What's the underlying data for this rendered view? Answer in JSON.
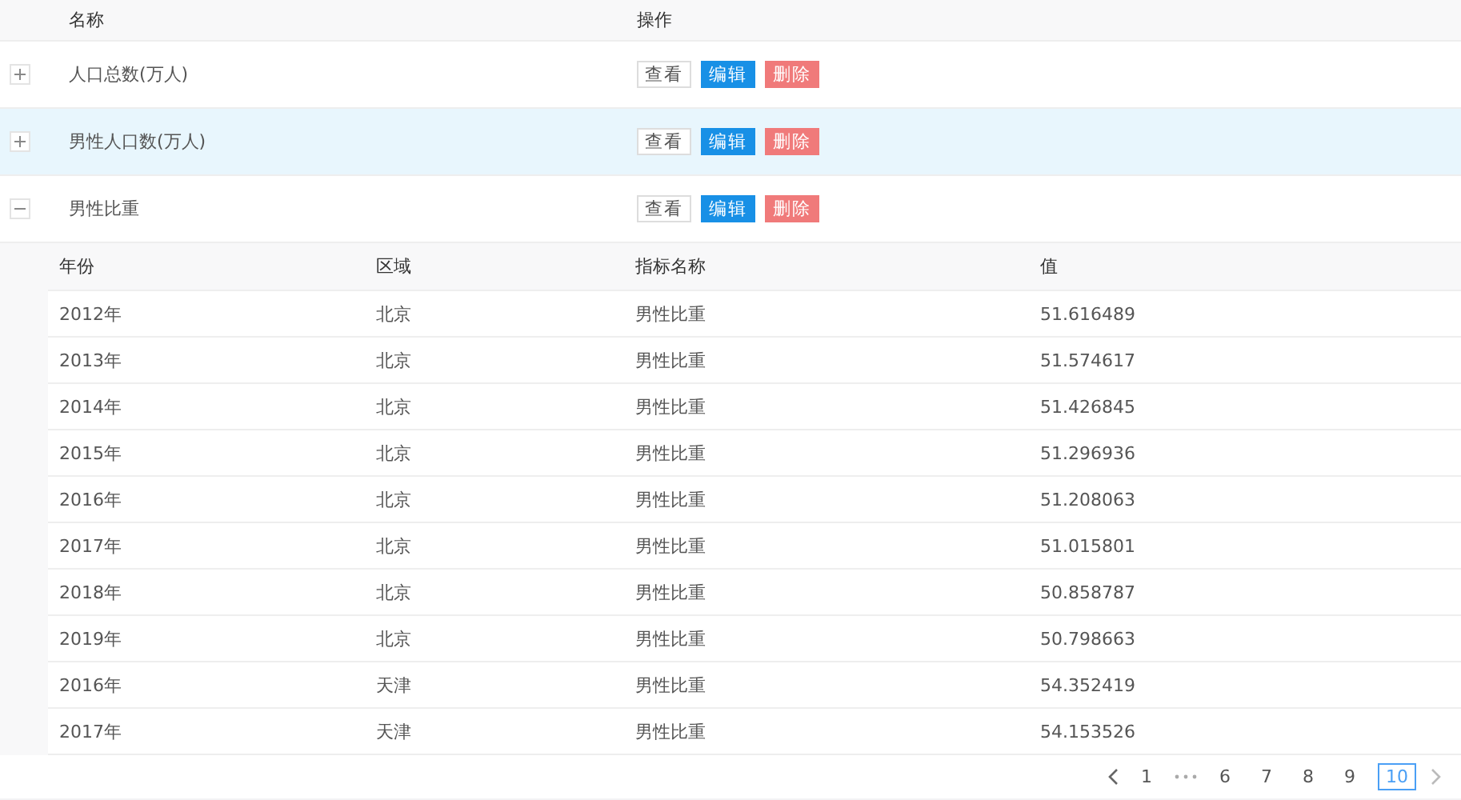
{
  "table": {
    "columns": [
      "名称",
      "操作"
    ],
    "rows": [
      {
        "name": "人口总数(万人)",
        "expanded": false,
        "selected": false,
        "actions": [
          {
            "kind": "view",
            "label": "查看"
          },
          {
            "kind": "edit",
            "label": "编辑"
          },
          {
            "kind": "delete",
            "label": "删除"
          }
        ]
      },
      {
        "name": "男性人口数(万人)",
        "expanded": false,
        "selected": true,
        "actions": [
          {
            "kind": "view",
            "label": "查看"
          },
          {
            "kind": "edit",
            "label": "编辑"
          },
          {
            "kind": "delete",
            "label": "删除"
          }
        ]
      },
      {
        "name": "男性比重",
        "expanded": true,
        "selected": false,
        "actions": [
          {
            "kind": "view",
            "label": "查看"
          },
          {
            "kind": "edit",
            "label": "编辑"
          },
          {
            "kind": "delete",
            "label": "删除"
          }
        ],
        "detail": {
          "columns": [
            "年份",
            "区域",
            "指标名称",
            "值"
          ],
          "rows": [
            [
              "2012年",
              "北京",
              "男性比重",
              "51.616489"
            ],
            [
              "2013年",
              "北京",
              "男性比重",
              "51.574617"
            ],
            [
              "2014年",
              "北京",
              "男性比重",
              "51.426845"
            ],
            [
              "2015年",
              "北京",
              "男性比重",
              "51.296936"
            ],
            [
              "2016年",
              "北京",
              "男性比重",
              "51.208063"
            ],
            [
              "2017年",
              "北京",
              "男性比重",
              "51.015801"
            ],
            [
              "2018年",
              "北京",
              "男性比重",
              "50.858787"
            ],
            [
              "2019年",
              "北京",
              "男性比重",
              "50.798663"
            ],
            [
              "2016年",
              "天津",
              "男性比重",
              "54.352419"
            ],
            [
              "2017年",
              "天津",
              "男性比重",
              "54.153526"
            ]
          ]
        }
      }
    ]
  },
  "pagination": {
    "pages": [
      {
        "label": "1",
        "selected": false
      },
      {
        "kind": "ellipsis"
      },
      {
        "label": "6",
        "selected": false
      },
      {
        "label": "7",
        "selected": false
      },
      {
        "label": "8",
        "selected": false
      },
      {
        "label": "9",
        "selected": false
      },
      {
        "label": "10",
        "selected": true
      }
    ]
  }
}
